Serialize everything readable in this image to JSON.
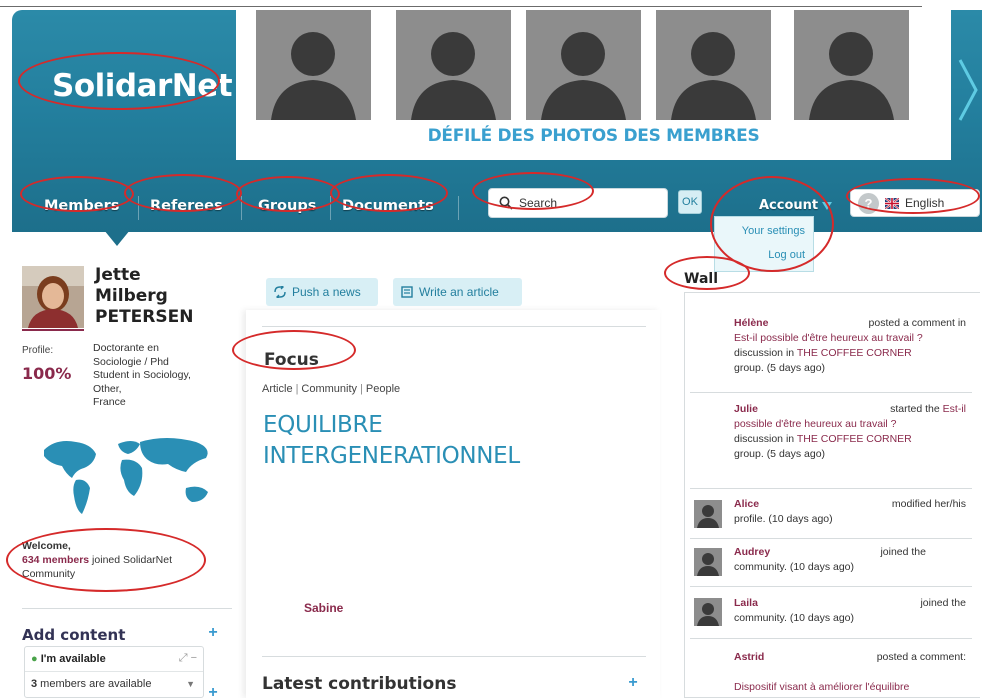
{
  "app": {
    "logo": "SolidarNet"
  },
  "photo_strip": {
    "caption": "DÉFILÉ DES PHOTOS DES MEMBRES",
    "photos": [
      "member-photo",
      "member-photo",
      "member-photo",
      "member-photo",
      "member-photo"
    ]
  },
  "nav": {
    "items": [
      "Members",
      "Referees",
      "Groups",
      "Documents"
    ],
    "search_text": "Search",
    "ok_label": "OK",
    "account_label": "Account",
    "language_label": "English",
    "help_label": "?"
  },
  "account_menu": {
    "items": [
      "Your settings",
      "Log out"
    ]
  },
  "profile": {
    "first_name": "Jette",
    "middle_name": "Milberg",
    "last_name": "PETERSEN",
    "profile_label": "Profile:",
    "profile_value": "100%",
    "bio_lines": [
      "Doctorante en",
      "Sociologie / Phd",
      "Student in Sociology,",
      "Other,",
      "France"
    ]
  },
  "welcome": {
    "greeting": "Welcome,",
    "members_count": "634 members",
    "joined_text": " joined SolidarNet",
    "community_text": "Community"
  },
  "add_content": {
    "title": "Add content",
    "plus": "+",
    "availability_title": "I'm available",
    "availability_controls": "⤢ −",
    "available_count": "3",
    "available_text": " members are available"
  },
  "center": {
    "push_news_label": "Push a news",
    "write_article_label": "Write an article",
    "focus_title": "Focus",
    "focus_tabs": [
      "Article",
      "Community",
      "People"
    ],
    "article_title": "EQUILIBRE INTERGENERATIONNEL",
    "author": "Sabine",
    "latest_title": "Latest contributions",
    "latest_plus": "+"
  },
  "wall": {
    "title": "Wall",
    "entries": [
      {
        "name": "Hélène",
        "action": "posted a comment in",
        "link": "Est-il possible d'être heureux au travail ?",
        "rest": " discussion in ",
        "group": "THE COFFEE CORNER",
        "tail": " group. (5 days ago)"
      },
      {
        "name": "Julie",
        "action": "started the",
        "link": "Est-il possible d'être heureux au travail ?",
        "rest": " discussion in ",
        "group": "THE COFFEE CORNER",
        "tail": " group. (5 days ago)"
      },
      {
        "name": "Alice",
        "action": "modified her/his",
        "tail": "profile. (10 days ago)"
      },
      {
        "name": "Audrey",
        "action": "joined the",
        "tail": "community. (10 days ago)"
      },
      {
        "name": "Laila",
        "action": "joined the",
        "tail": "community. (10 days ago)"
      },
      {
        "name": "Astrid",
        "action": "posted a comment:",
        "tail": "Dispositif visant à améliorer l'équilibre"
      }
    ]
  },
  "colors": {
    "header_teal": "#237f9e",
    "accent_blue": "#2a8fb5",
    "name_maroon": "#8a2a4c",
    "annotation_red": "#d52a2a"
  }
}
